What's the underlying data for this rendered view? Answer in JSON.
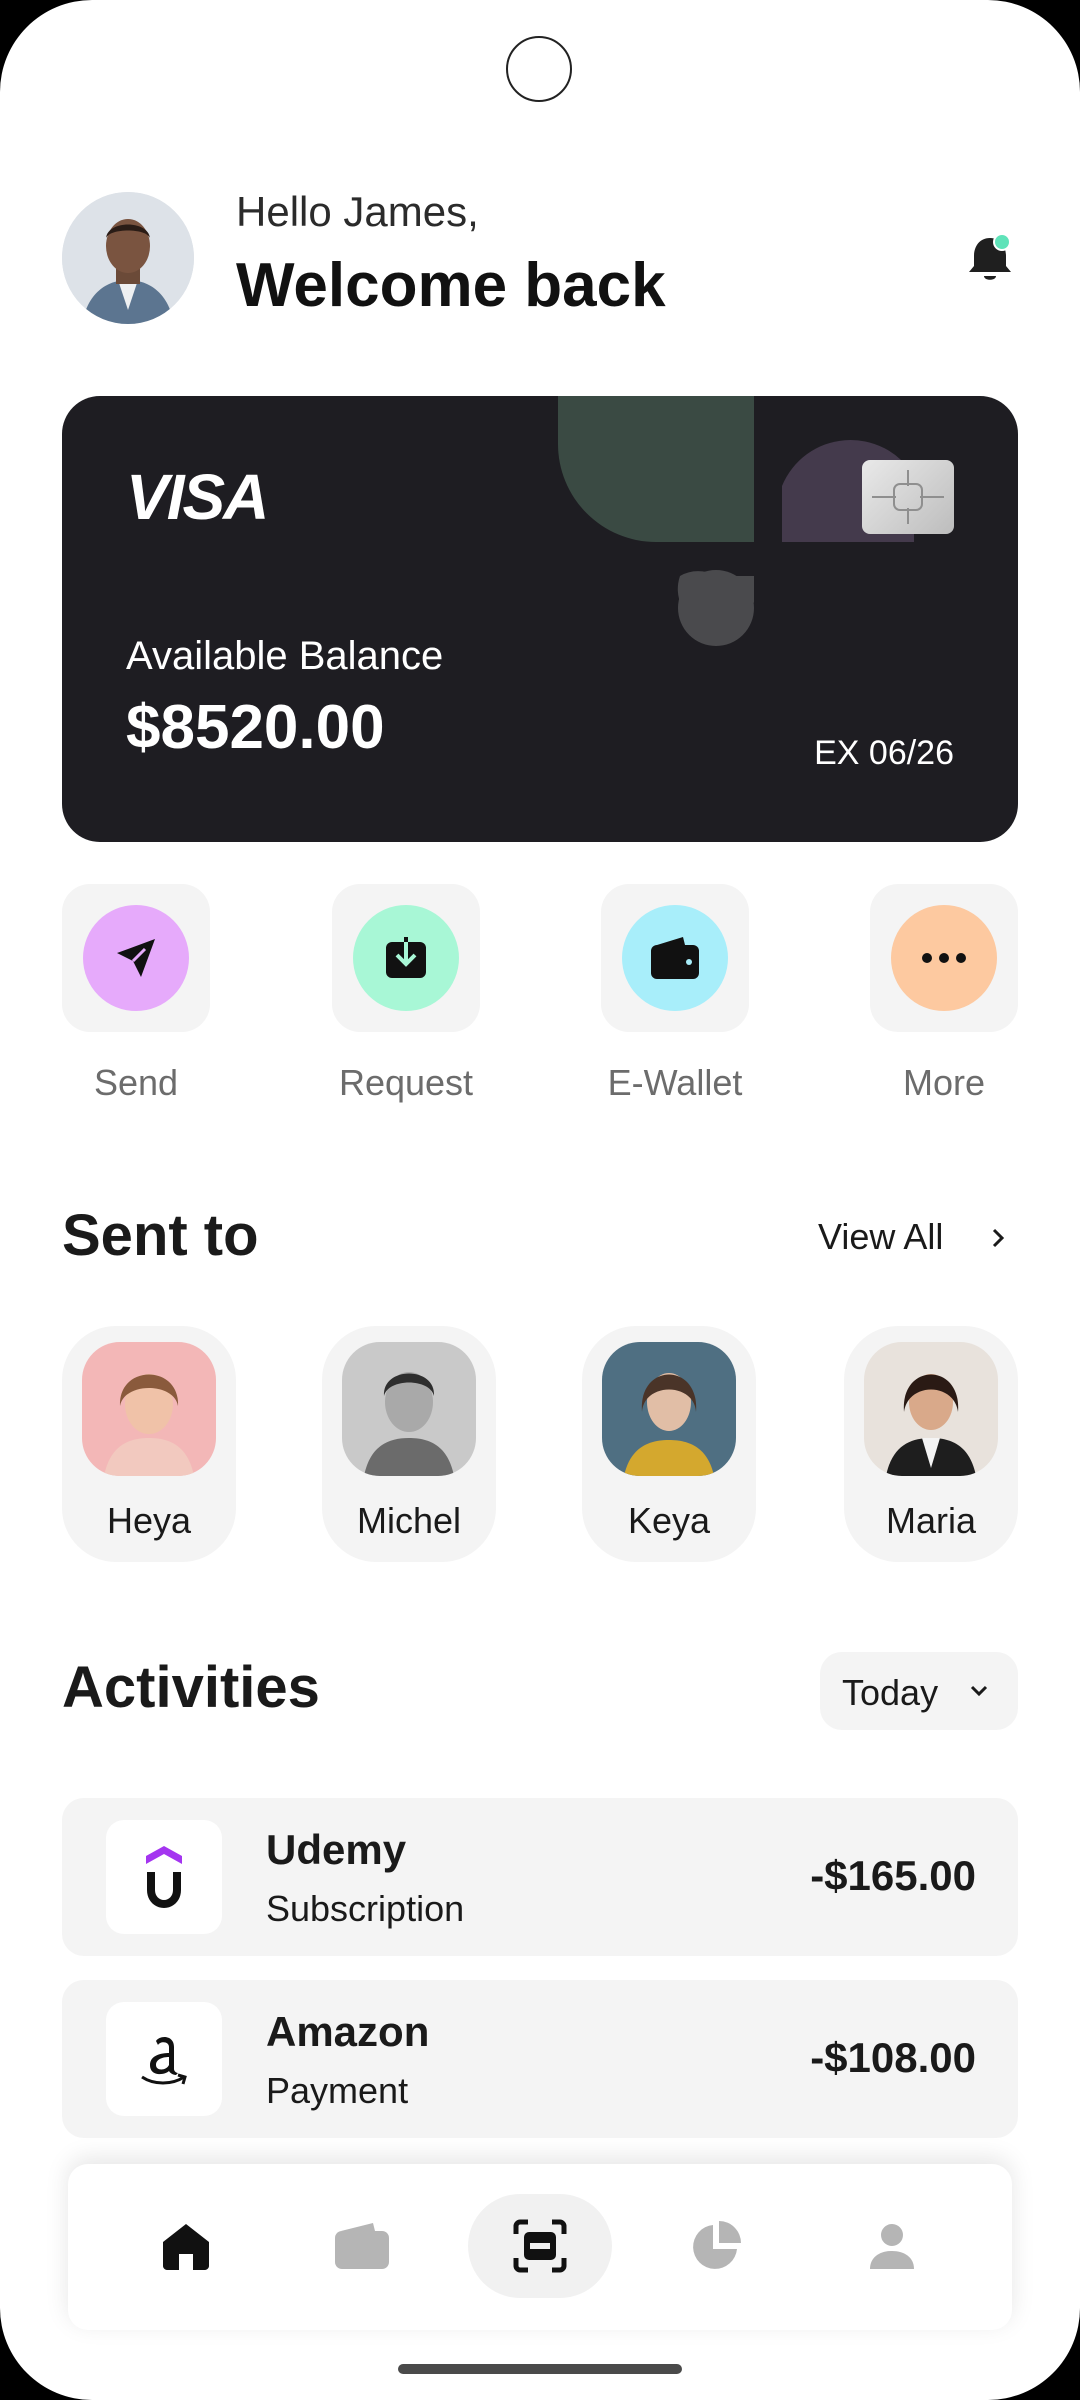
{
  "header": {
    "greeting": "Hello James,",
    "welcome": "Welcome back",
    "avatar_icon": "user-avatar",
    "notification_icon": "bell-icon",
    "notification_dot_color": "#5fe3b9"
  },
  "card": {
    "brand": "VISA",
    "balance_label": "Available Balance",
    "balance": "$8520.00",
    "expiry": "EX 06/26",
    "background_color": "#1e1d22"
  },
  "actions": [
    {
      "label": "Send",
      "icon": "send-icon",
      "color": "#e6aafb"
    },
    {
      "label": "Request",
      "icon": "download-icon",
      "color": "#a8f7d6"
    },
    {
      "label": "E-Wallet",
      "icon": "wallet-icon",
      "color": "#a8eefa"
    },
    {
      "label": "More",
      "icon": "more-icon",
      "color": "#fdc9a0"
    }
  ],
  "sent_to": {
    "title": "Sent to",
    "view_all": "View All",
    "people": [
      {
        "name": "Heya"
      },
      {
        "name": "Michel"
      },
      {
        "name": "Keya"
      },
      {
        "name": "Maria"
      }
    ]
  },
  "activities": {
    "title": "Activities",
    "filter": "Today",
    "items": [
      {
        "name": "Udemy",
        "type": "Subscription",
        "amount": "-$165.00",
        "logo": "udemy-logo"
      },
      {
        "name": "Amazon",
        "type": "Payment",
        "amount": "-$108.00",
        "logo": "amazon-logo"
      }
    ]
  },
  "nav": {
    "items": [
      "home-icon",
      "wallet-icon",
      "scan-icon",
      "pie-chart-icon",
      "profile-icon"
    ],
    "active": "home-icon"
  }
}
